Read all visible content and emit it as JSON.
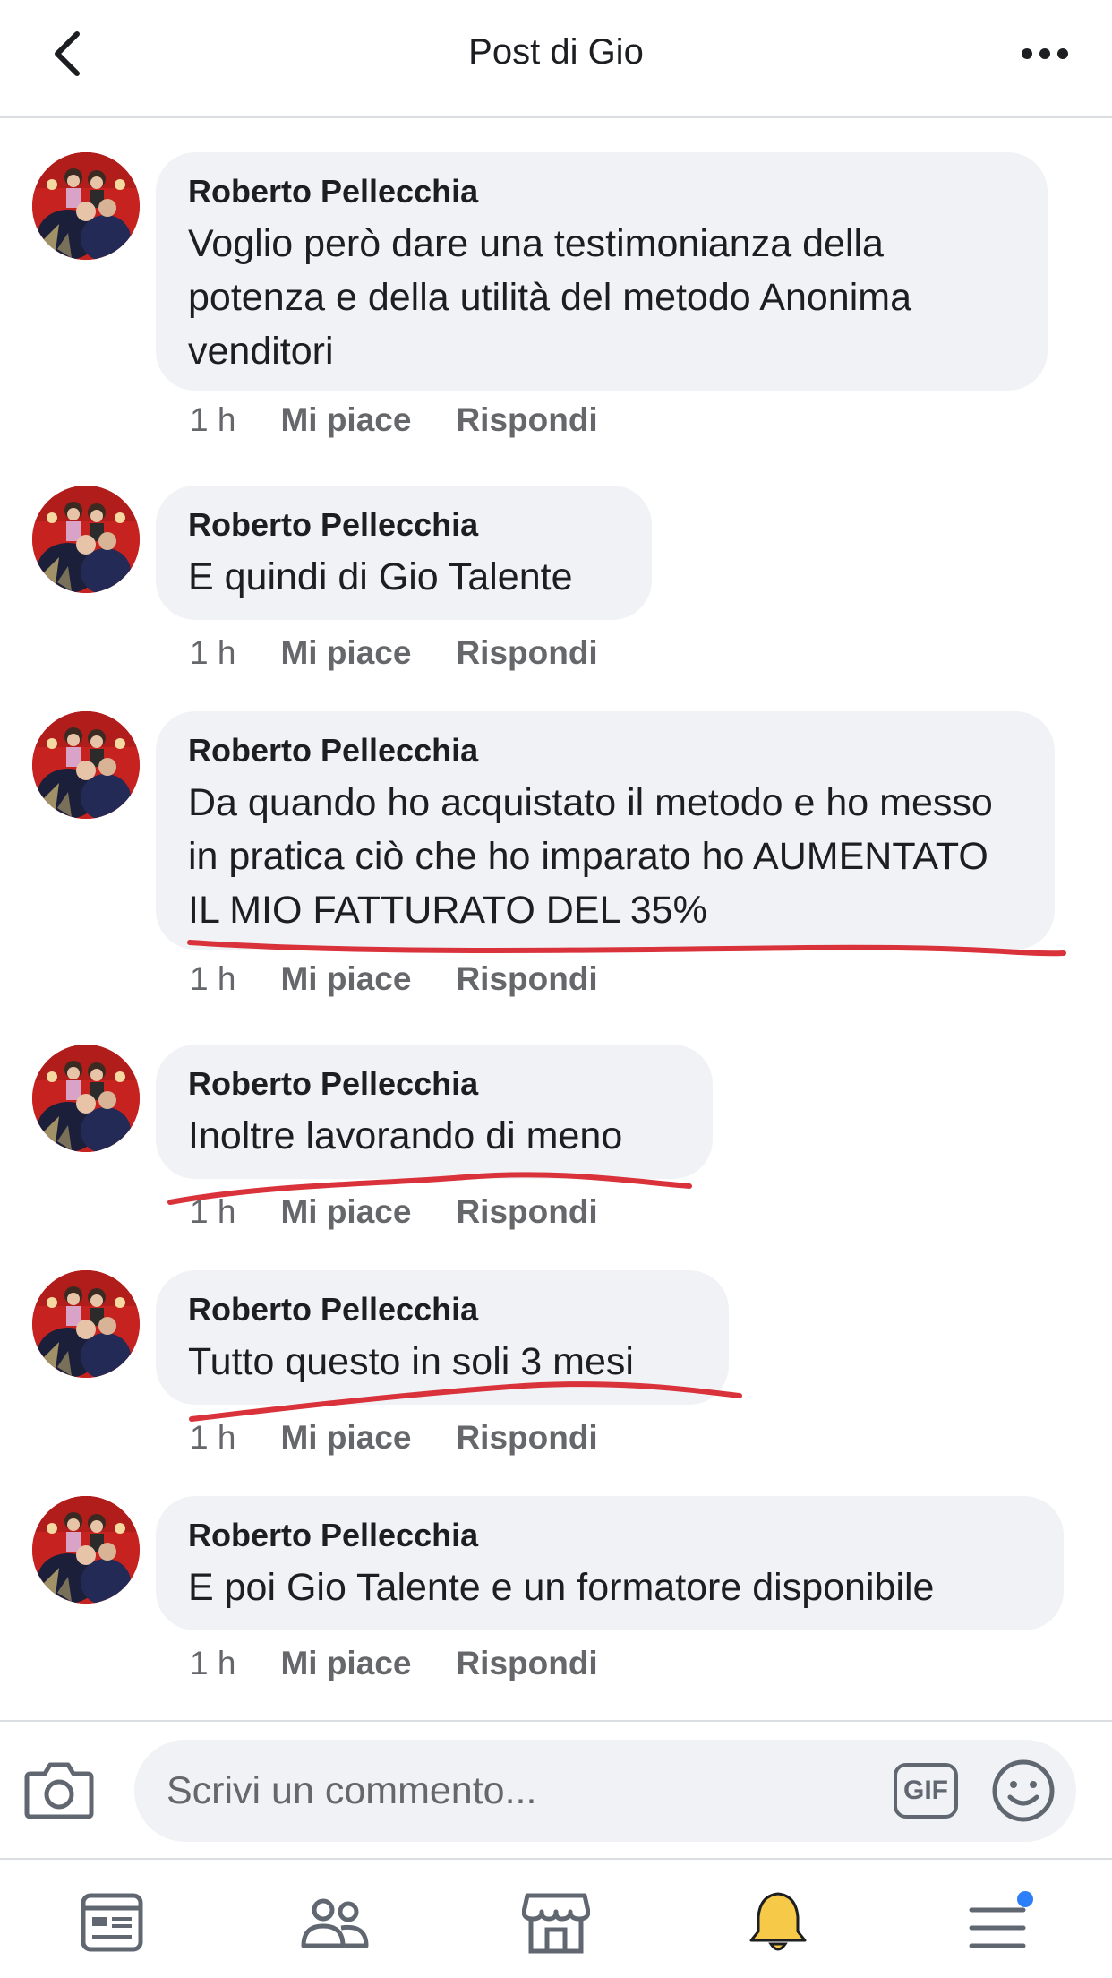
{
  "header": {
    "title": "Post di Gio",
    "back_icon": "chevron-left-icon",
    "more_icon": "more-dots-icon"
  },
  "comments": [
    {
      "author": "Roberto Pellecchia",
      "text": "Voglio però dare una testimonianza della potenza e della utilità del metodo Anonima venditori",
      "time": "1 h",
      "like_label": "Mi piace",
      "reply_label": "Rispondi"
    },
    {
      "author": "Roberto Pellecchia",
      "text": "E quindi di Gio Talente",
      "time": "1 h",
      "like_label": "Mi piace",
      "reply_label": "Rispondi"
    },
    {
      "author": "Roberto Pellecchia",
      "text": "Da quando ho acquistato il metodo e ho messo in pratica ciò che ho imparato ho AUMENTATO IL MIO FATTURATO DEL 35%",
      "time": "1 h",
      "like_label": "Mi piace",
      "reply_label": "Rispondi"
    },
    {
      "author": "Roberto Pellecchia",
      "text": "Inoltre lavorando di meno",
      "time": "1 h",
      "like_label": "Mi piace",
      "reply_label": "Rispondi"
    },
    {
      "author": "Roberto Pellecchia",
      "text": "Tutto questo in soli 3 mesi",
      "time": "1 h",
      "like_label": "Mi piace",
      "reply_label": "Rispondi"
    },
    {
      "author": "Roberto Pellecchia",
      "text": "E poi Gio Talente e un formatore disponibile",
      "time": "1 h",
      "like_label": "Mi piace",
      "reply_label": "Rispondi"
    }
  ],
  "composer": {
    "placeholder": "Scrivi un commento...",
    "gif_label": "GIF",
    "camera_icon": "camera-icon",
    "emoji_icon": "smiley-icon"
  },
  "tabbar": {
    "items": [
      {
        "icon": "news-feed-icon",
        "active": false
      },
      {
        "icon": "friends-icon",
        "active": false
      },
      {
        "icon": "marketplace-icon",
        "active": false
      },
      {
        "icon": "bell-icon",
        "active": true
      },
      {
        "icon": "menu-icon",
        "active": false,
        "badge": true
      }
    ]
  },
  "colors": {
    "bubble_bg": "#f0f2f5",
    "meta_text": "#65676b",
    "annotation_red": "#d9323b",
    "bell_active": "#f7c948",
    "badge_blue": "#2d7ff9"
  }
}
